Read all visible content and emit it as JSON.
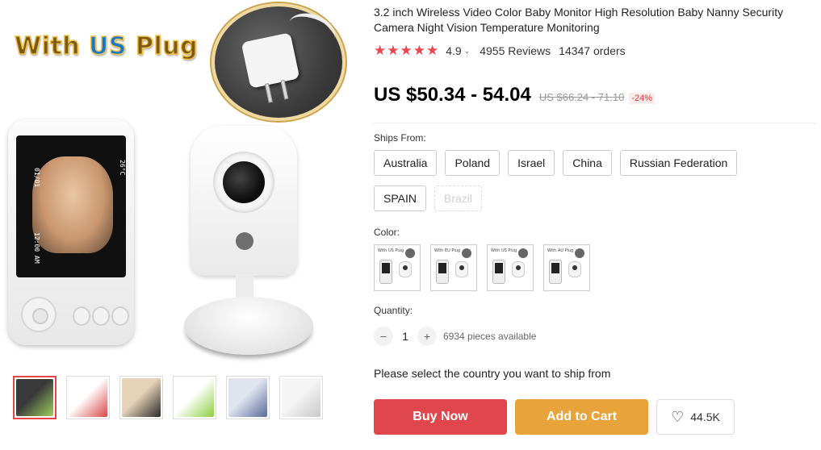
{
  "gallery": {
    "banner": {
      "word1": "With",
      "word2": "US",
      "word3": "Plug"
    },
    "thumbnails": [
      {
        "name": "thumb-1",
        "colors": [
          "#3a3a3a",
          "#9ed05b"
        ]
      },
      {
        "name": "thumb-2",
        "colors": [
          "#ffffff",
          "#d94848"
        ]
      },
      {
        "name": "thumb-3",
        "colors": [
          "#e7d3b8",
          "#2a2a2a"
        ]
      },
      {
        "name": "thumb-4",
        "colors": [
          "#ffffff",
          "#8ccf3e"
        ]
      },
      {
        "name": "thumb-5",
        "colors": [
          "#dfe4ef",
          "#5a6a9a"
        ]
      },
      {
        "name": "thumb-6",
        "colors": [
          "#f5f5f5",
          "#c9c9c9"
        ]
      }
    ]
  },
  "product": {
    "title": "3.2 inch Wireless Video Color Baby Monitor High Resolution Baby Nanny Security Camera Night Vision Temperature Monitoring",
    "rating": "4.9",
    "stars": "★★★★★",
    "reviews": "4955 Reviews",
    "orders": "14347 orders",
    "price": "US $50.34 - 54.04",
    "original_price": "US $66.24 - 71.10",
    "discount": "-24%"
  },
  "shipping": {
    "label": "Ships From:",
    "options": [
      {
        "label": "Australia",
        "enabled": true
      },
      {
        "label": "Poland",
        "enabled": true
      },
      {
        "label": "Israel",
        "enabled": true
      },
      {
        "label": "China",
        "enabled": true
      },
      {
        "label": "Russian Federation",
        "enabled": true
      },
      {
        "label": "SPAIN",
        "enabled": true
      },
      {
        "label": "Brazil",
        "enabled": false
      }
    ]
  },
  "color": {
    "label": "Color:",
    "options": [
      "With US Plug",
      "With EU Plug",
      "With US Plug",
      "With AU Plug"
    ]
  },
  "quantity": {
    "label": "Quantity:",
    "minus": "−",
    "plus": "+",
    "value": "1",
    "available": "6934 pieces available"
  },
  "notice": "Please select the country you want to ship from",
  "actions": {
    "buy_now": "Buy Now",
    "add_to_cart": "Add to Cart",
    "wishlist_count": "44.5K",
    "heart": "♡"
  },
  "colors": {
    "buy_now": "#e0474c",
    "add_to_cart": "#e8a33b",
    "stars": "#f0444e",
    "discount": "#e3342f"
  }
}
